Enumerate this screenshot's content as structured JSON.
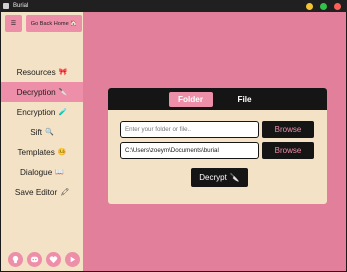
{
  "window": {
    "title": "Burial"
  },
  "colors": {
    "accent": "#ee8fa9",
    "background": "#e27f9b",
    "panel": "#f3e2c5",
    "dark": "#151515"
  },
  "sidebar": {
    "menu_icon": "hamburger-icon",
    "home_button": "Go Back Home 🏠",
    "items": [
      {
        "label": "Resources",
        "icon": "🎀"
      },
      {
        "label": "Decryption",
        "icon": "🔪",
        "active": true
      },
      {
        "label": "Encryption",
        "icon": "🧪"
      },
      {
        "label": "Sift",
        "icon": "🔍"
      },
      {
        "label": "Templates",
        "icon": "🤒"
      },
      {
        "label": "Dialogue",
        "icon": "📖"
      },
      {
        "label": "Save Editor",
        "icon": "🖍"
      }
    ],
    "social": [
      "github-icon",
      "discord-icon",
      "heart-icon",
      "play-icon"
    ]
  },
  "card": {
    "tabs": {
      "folder": "Folder",
      "file": "File"
    },
    "input1": {
      "placeholder": "Enter your folder or file..",
      "value": ""
    },
    "input2": {
      "value": "C:\\Users\\zoeym\\Documents\\burial"
    },
    "browse_label": "Browse",
    "decrypt_label": "Decrypt",
    "decrypt_icon": "🔪"
  }
}
